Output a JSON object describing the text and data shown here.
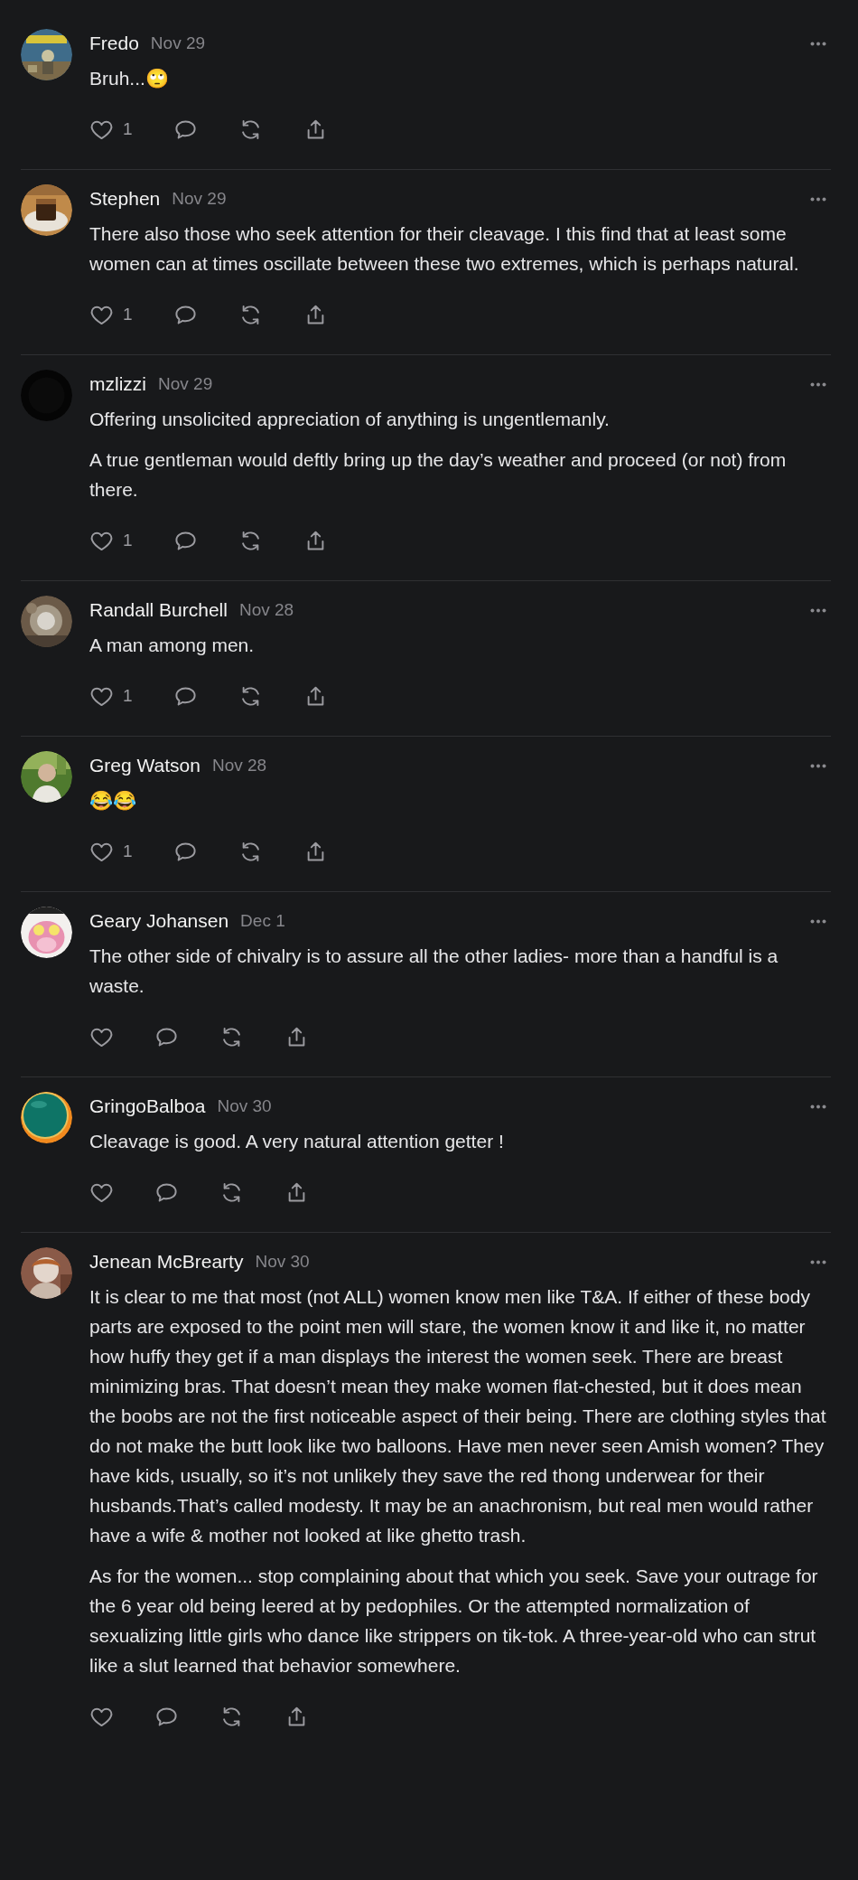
{
  "comments": [
    {
      "author": "Fredo",
      "date": "Nov 29",
      "paragraphs": [
        "Bruh...🙄"
      ],
      "likes": "1"
    },
    {
      "author": "Stephen",
      "date": "Nov 29",
      "paragraphs": [
        "There also those who seek attention for their cleavage. I this find that at least some women can at times oscillate between these two extremes, which is perhaps natural."
      ],
      "likes": "1"
    },
    {
      "author": "mzlizzi",
      "date": "Nov 29",
      "paragraphs": [
        "Offering unsolicited appreciation of anything is ungentlemanly.",
        "A true gentleman would deftly bring up the day’s weather and proceed (or not) from there."
      ],
      "likes": "1"
    },
    {
      "author": "Randall Burchell",
      "date": "Nov 28",
      "paragraphs": [
        "A man among men."
      ],
      "likes": "1"
    },
    {
      "author": "Greg Watson",
      "date": "Nov 28",
      "paragraphs": [
        "😂😂"
      ],
      "likes": "1"
    },
    {
      "author": "Geary Johansen",
      "date": "Dec 1",
      "paragraphs": [
        "The other side of chivalry is to assure all the other ladies- more than a handful is a waste."
      ]
    },
    {
      "author": "GringoBalboa",
      "date": "Nov 30",
      "paragraphs": [
        "Cleavage is good. A very natural attention getter !"
      ]
    },
    {
      "author": "Jenean McBrearty",
      "date": "Nov 30",
      "paragraphs": [
        "It is clear to me that most (not ALL) women know men like T&A. If either of these body parts are exposed to the point men will stare, the women know it and like it, no matter how huffy they get if a man displays the interest the women seek. There are breast minimizing bras. That doesn’t mean they make women flat-chested, but it does mean the boobs are not the first noticeable aspect of their being. There are clothing styles that do not make the butt look like two balloons. Have men never seen Amish women? They have kids, usually, so it’s not unlikely they save the red thong underwear for their husbands.That’s called modesty. It may be an anachronism, but real men would rather have a wife & mother not looked at like ghetto trash.",
        "As for the women... stop complaining about that which you seek. Save your outrage for the 6 year old being leered at by pedophiles. Or the attempted normalization of sexualizing little girls who dance like strippers on tik-tok. A three-year-old who can strut like a slut learned that behavior somewhere."
      ]
    }
  ]
}
